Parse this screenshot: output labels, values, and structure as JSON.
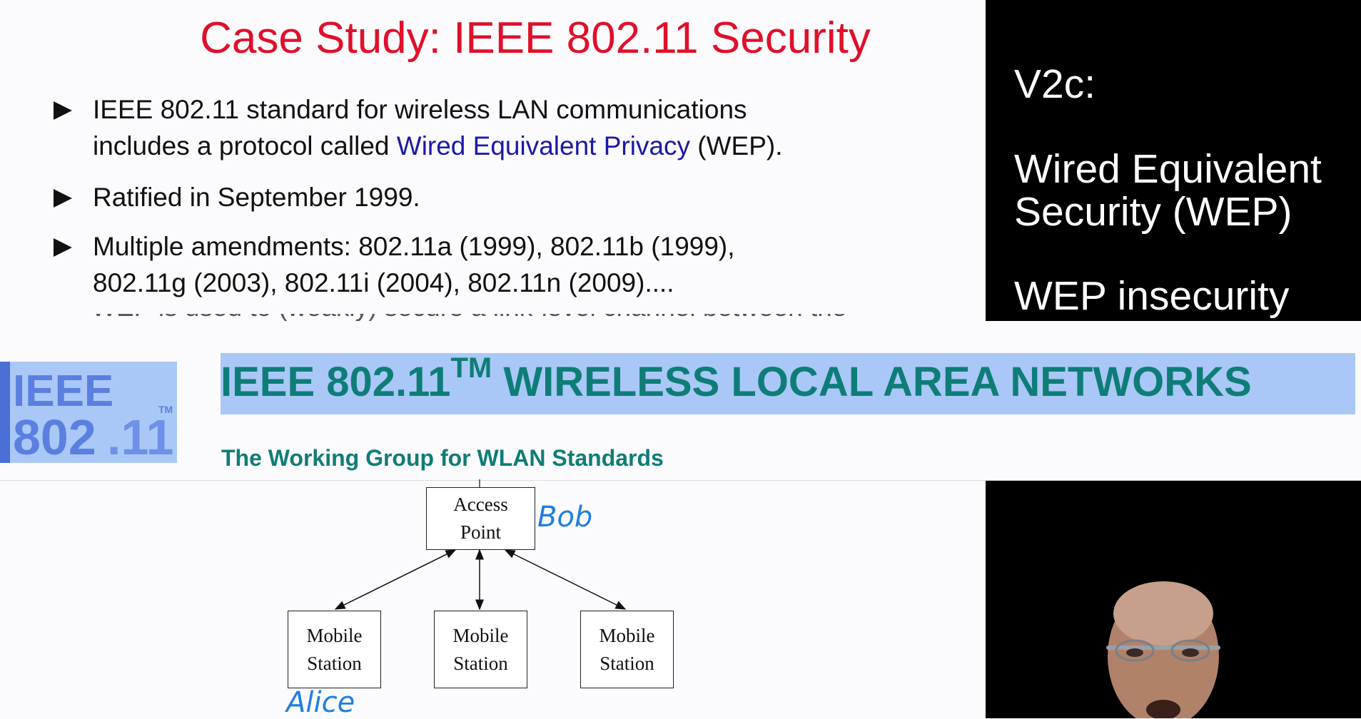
{
  "slide": {
    "title": "Case Study: IEEE 802.11 Security",
    "bullets": [
      {
        "line1": "IEEE 802.11 standard for wireless LAN communications",
        "line2_pre": "includes a protocol called ",
        "line2_link": "Wired Equivalent Privacy",
        "line2_post": " (WEP)."
      },
      {
        "line1": "Ratified in September 1999."
      },
      {
        "line1": "Multiple amendments: 802.11a (1999), 802.11b (1999),",
        "line2": "802.11g (2003), 802.11i (2004), 802.11n (2009)...."
      }
    ],
    "bullet4_partial": "WEP is used to (weakly) secure a link-level channel between the..."
  },
  "side_panel": {
    "lines": [
      "V2c:",
      "Wired Equivalent",
      "Security (WEP)",
      "WEP insecurity"
    ]
  },
  "banner": {
    "logo_text_top": "IEEE",
    "logo_text_bottom": "802",
    "logo_text_dot": ".11",
    "logo_tm": "TM",
    "title_main": "IEEE 802.11",
    "title_sup": "TM",
    "title_rest": " WIRELESS LOCAL AREA NETWORKS",
    "subtitle": "The Working Group for WLAN Standards",
    "colors": {
      "teal": "#0e7d77",
      "highlight": "#a9c8f7"
    }
  },
  "diagram": {
    "access_point": {
      "line1": "Access",
      "line2": "Point"
    },
    "stations": [
      {
        "line1": "Mobile",
        "line2": "Station"
      },
      {
        "line1": "Mobile",
        "line2": "Station"
      },
      {
        "line1": "Mobile",
        "line2": "Station"
      }
    ],
    "annotations": {
      "bob": "Bob",
      "alice": "Alice"
    }
  },
  "colors": {
    "title_red": "#e0102a",
    "link_blue": "#1a1aa6",
    "ink_blue": "#1f7fe0"
  }
}
